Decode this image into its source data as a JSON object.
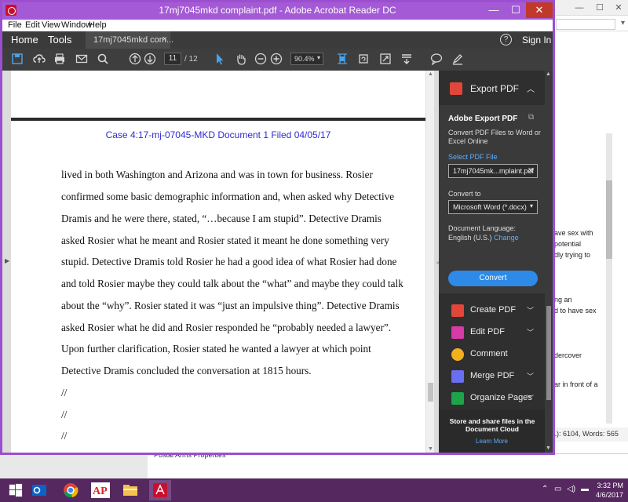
{
  "window": {
    "title": "17mj7045mkd complaint.pdf - Adobe Acrobat Reader DC",
    "minimize": "—",
    "maximize": "☐",
    "close": "✕"
  },
  "menu": [
    "File",
    "Edit",
    "View",
    "Window",
    "Help"
  ],
  "nav": {
    "home": "Home",
    "tools": "Tools",
    "doc_tab": "17mj7045mkd com...",
    "doc_tab_close": "×",
    "help": "?",
    "sign_in": "Sign In"
  },
  "toolbar": {
    "page_current": "11",
    "page_total": "/ 12",
    "zoom": "90.4%"
  },
  "document": {
    "header": "Case 4:17-mj-07045-MKD     Document 1     Filed 04/05/17",
    "lines": [
      "lived in both Washington and Arizona and was in town for business. Rosier",
      "confirmed some basic demographic information and, when asked why Detective",
      "Dramis and he were there, stated, “…because I am stupid”. Detective Dramis",
      "asked Rosier what he meant and Rosier stated it meant he done something very",
      "stupid. Detective Dramis told Rosier he had a good idea of what Rosier had done",
      "and told Rosier maybe they could talk about the “what” and maybe they could talk",
      "about the “why”. Rosier stated it was “just an impulsive thing”. Detective Dramis",
      "asked Rosier what he did and Rosier responded he “probably needed a lawyer”.",
      "Upon further clarification, Rosier stated he wanted a lawyer at which point",
      "Detective Dramis concluded the conversation at 1815 hours.",
      "//",
      "//",
      "//"
    ]
  },
  "pane": {
    "export_label": "Export PDF",
    "panel_title": "Adobe Export PDF",
    "panel_desc": "Convert PDF Files to Word or Excel Online",
    "select_file": "Select PDF File",
    "file_name": "17mj7045mk...mplaint.pdf",
    "convert_to": "Convert to",
    "format": "Microsoft Word (*.docx)",
    "doc_lang_label": "Document Language:",
    "doc_lang_value": "English (U.S.)",
    "change": "Change",
    "convert_button": "Convert",
    "tools": [
      {
        "label": "Create PDF",
        "chevron": true,
        "color": "#e0473a"
      },
      {
        "label": "Edit PDF",
        "chevron": true,
        "color": "#d43ba6"
      },
      {
        "label": "Comment",
        "chevron": false,
        "color": "#f2b11d"
      },
      {
        "label": "Merge PDF",
        "chevron": true,
        "color": "#6a6ef0"
      },
      {
        "label": "Organize Pages",
        "chevron": true,
        "color": "#1fa34a"
      }
    ],
    "cloud_text": "Store and share files in the Document Cloud",
    "learn_more": "Learn More"
  },
  "background_window": {
    "snippets": [
      "ave sex with",
      "potential",
      "dly trying to",
      "ng an",
      "d to have sex",
      "dercover",
      "ar in front of a"
    ],
    "status": "L): 6104, Words: 565",
    "bottom_label": "Postal Arms Properties"
  },
  "taskbar": {
    "time": "3:32 PM",
    "date": "4/6/2017"
  },
  "colors": {
    "window_border": "#9b4fd0",
    "accent_blue": "#2d8ae6",
    "header_blue": "#2d2dd1",
    "taskbar": "#55285f"
  }
}
